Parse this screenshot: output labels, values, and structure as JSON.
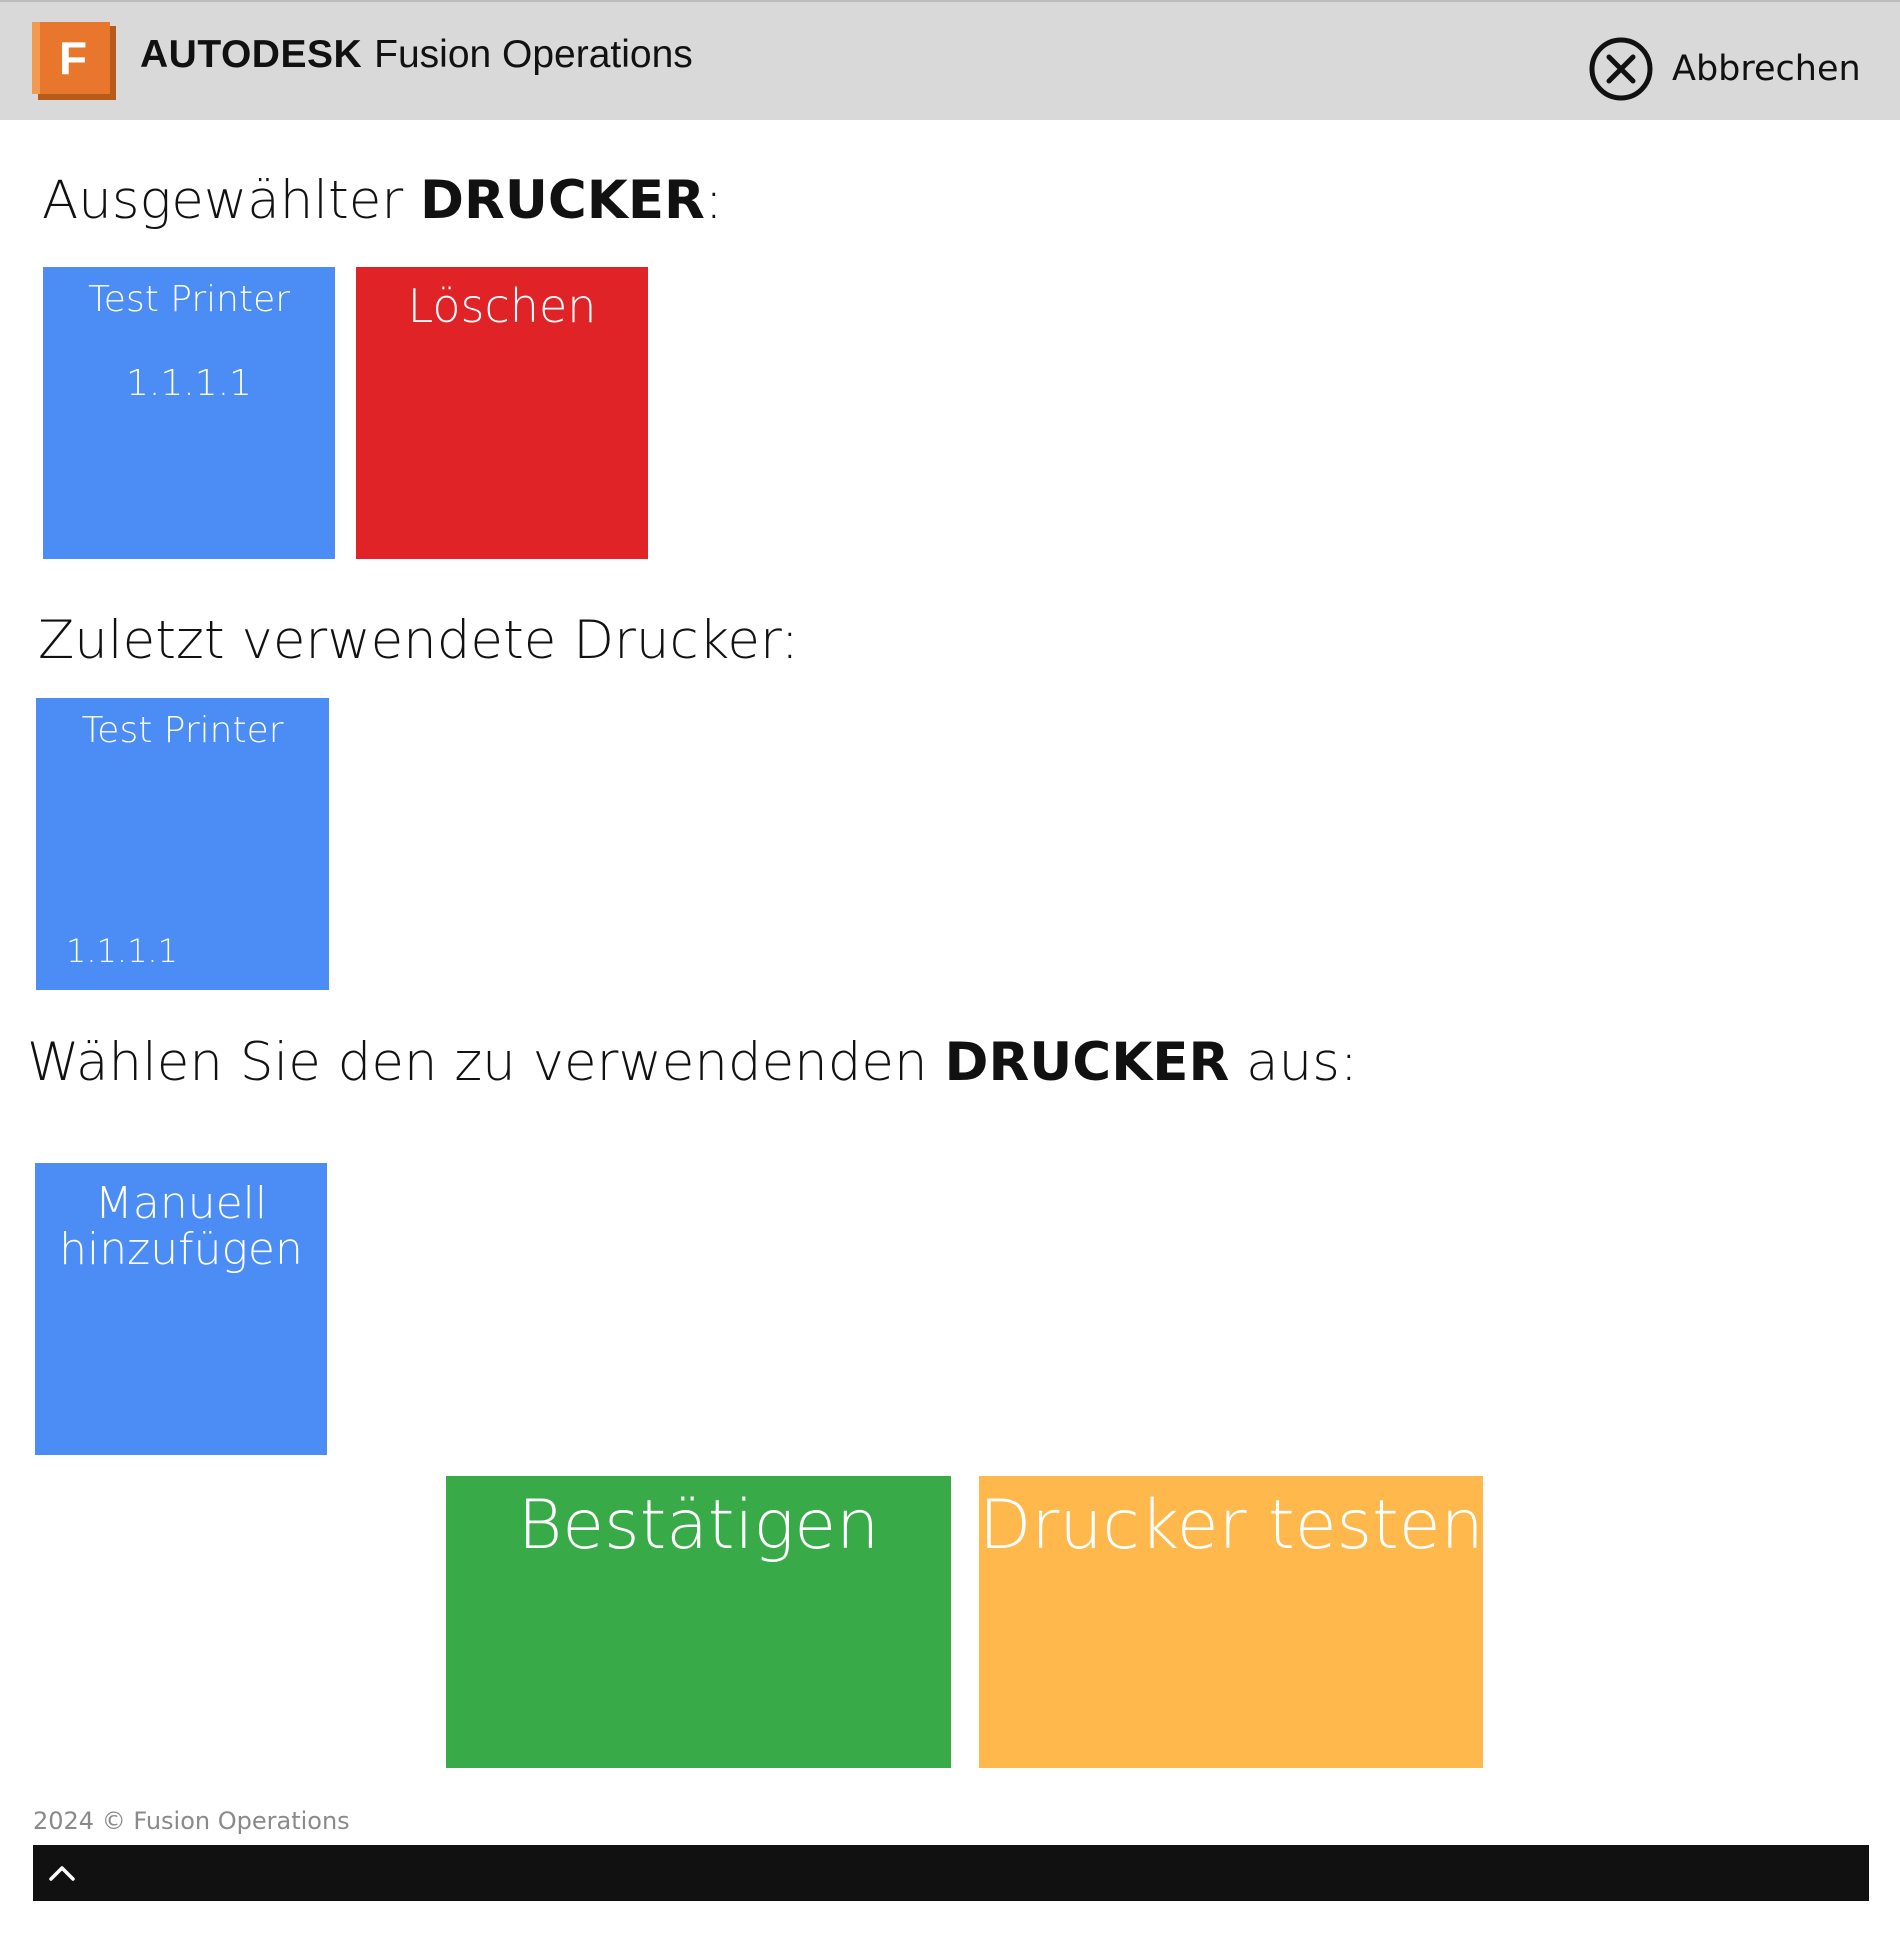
{
  "header": {
    "logo_letter": "F",
    "brand_bold": "AUTODESK",
    "brand_product": "Fusion Operations",
    "cancel_label": "Abbrechen",
    "cancel_icon": "close-circle-icon"
  },
  "selected": {
    "heading_prefix": "Ausgewählter ",
    "heading_bold": "DRUCKER",
    "heading_suffix": ":",
    "printer_name": "Test Printer",
    "printer_ip": "1.1.1.1",
    "delete_label": "Löschen"
  },
  "recent": {
    "heading": "Zuletzt verwendete Drucker:",
    "printers": [
      {
        "name": "Test Printer",
        "ip": "1.1.1.1"
      }
    ]
  },
  "choose": {
    "heading_prefix": "Wählen Sie den zu verwendenden ",
    "heading_bold": "DRUCKER",
    "heading_suffix": " aus:",
    "manual_line1": "Manuell",
    "manual_line2": "hinzufügen"
  },
  "actions": {
    "confirm_label": "Bestätigen",
    "test_label": "Drucker testen"
  },
  "footer": {
    "copyright": "2024 © Fusion Operations",
    "up_icon": "chevron-up-icon"
  },
  "colors": {
    "blue": "#4b8cf5",
    "red": "#e02326",
    "green": "#38aa47",
    "orange": "#feb84b",
    "header_bg": "#d9d9d9",
    "logo_orange": "#e8762d"
  }
}
